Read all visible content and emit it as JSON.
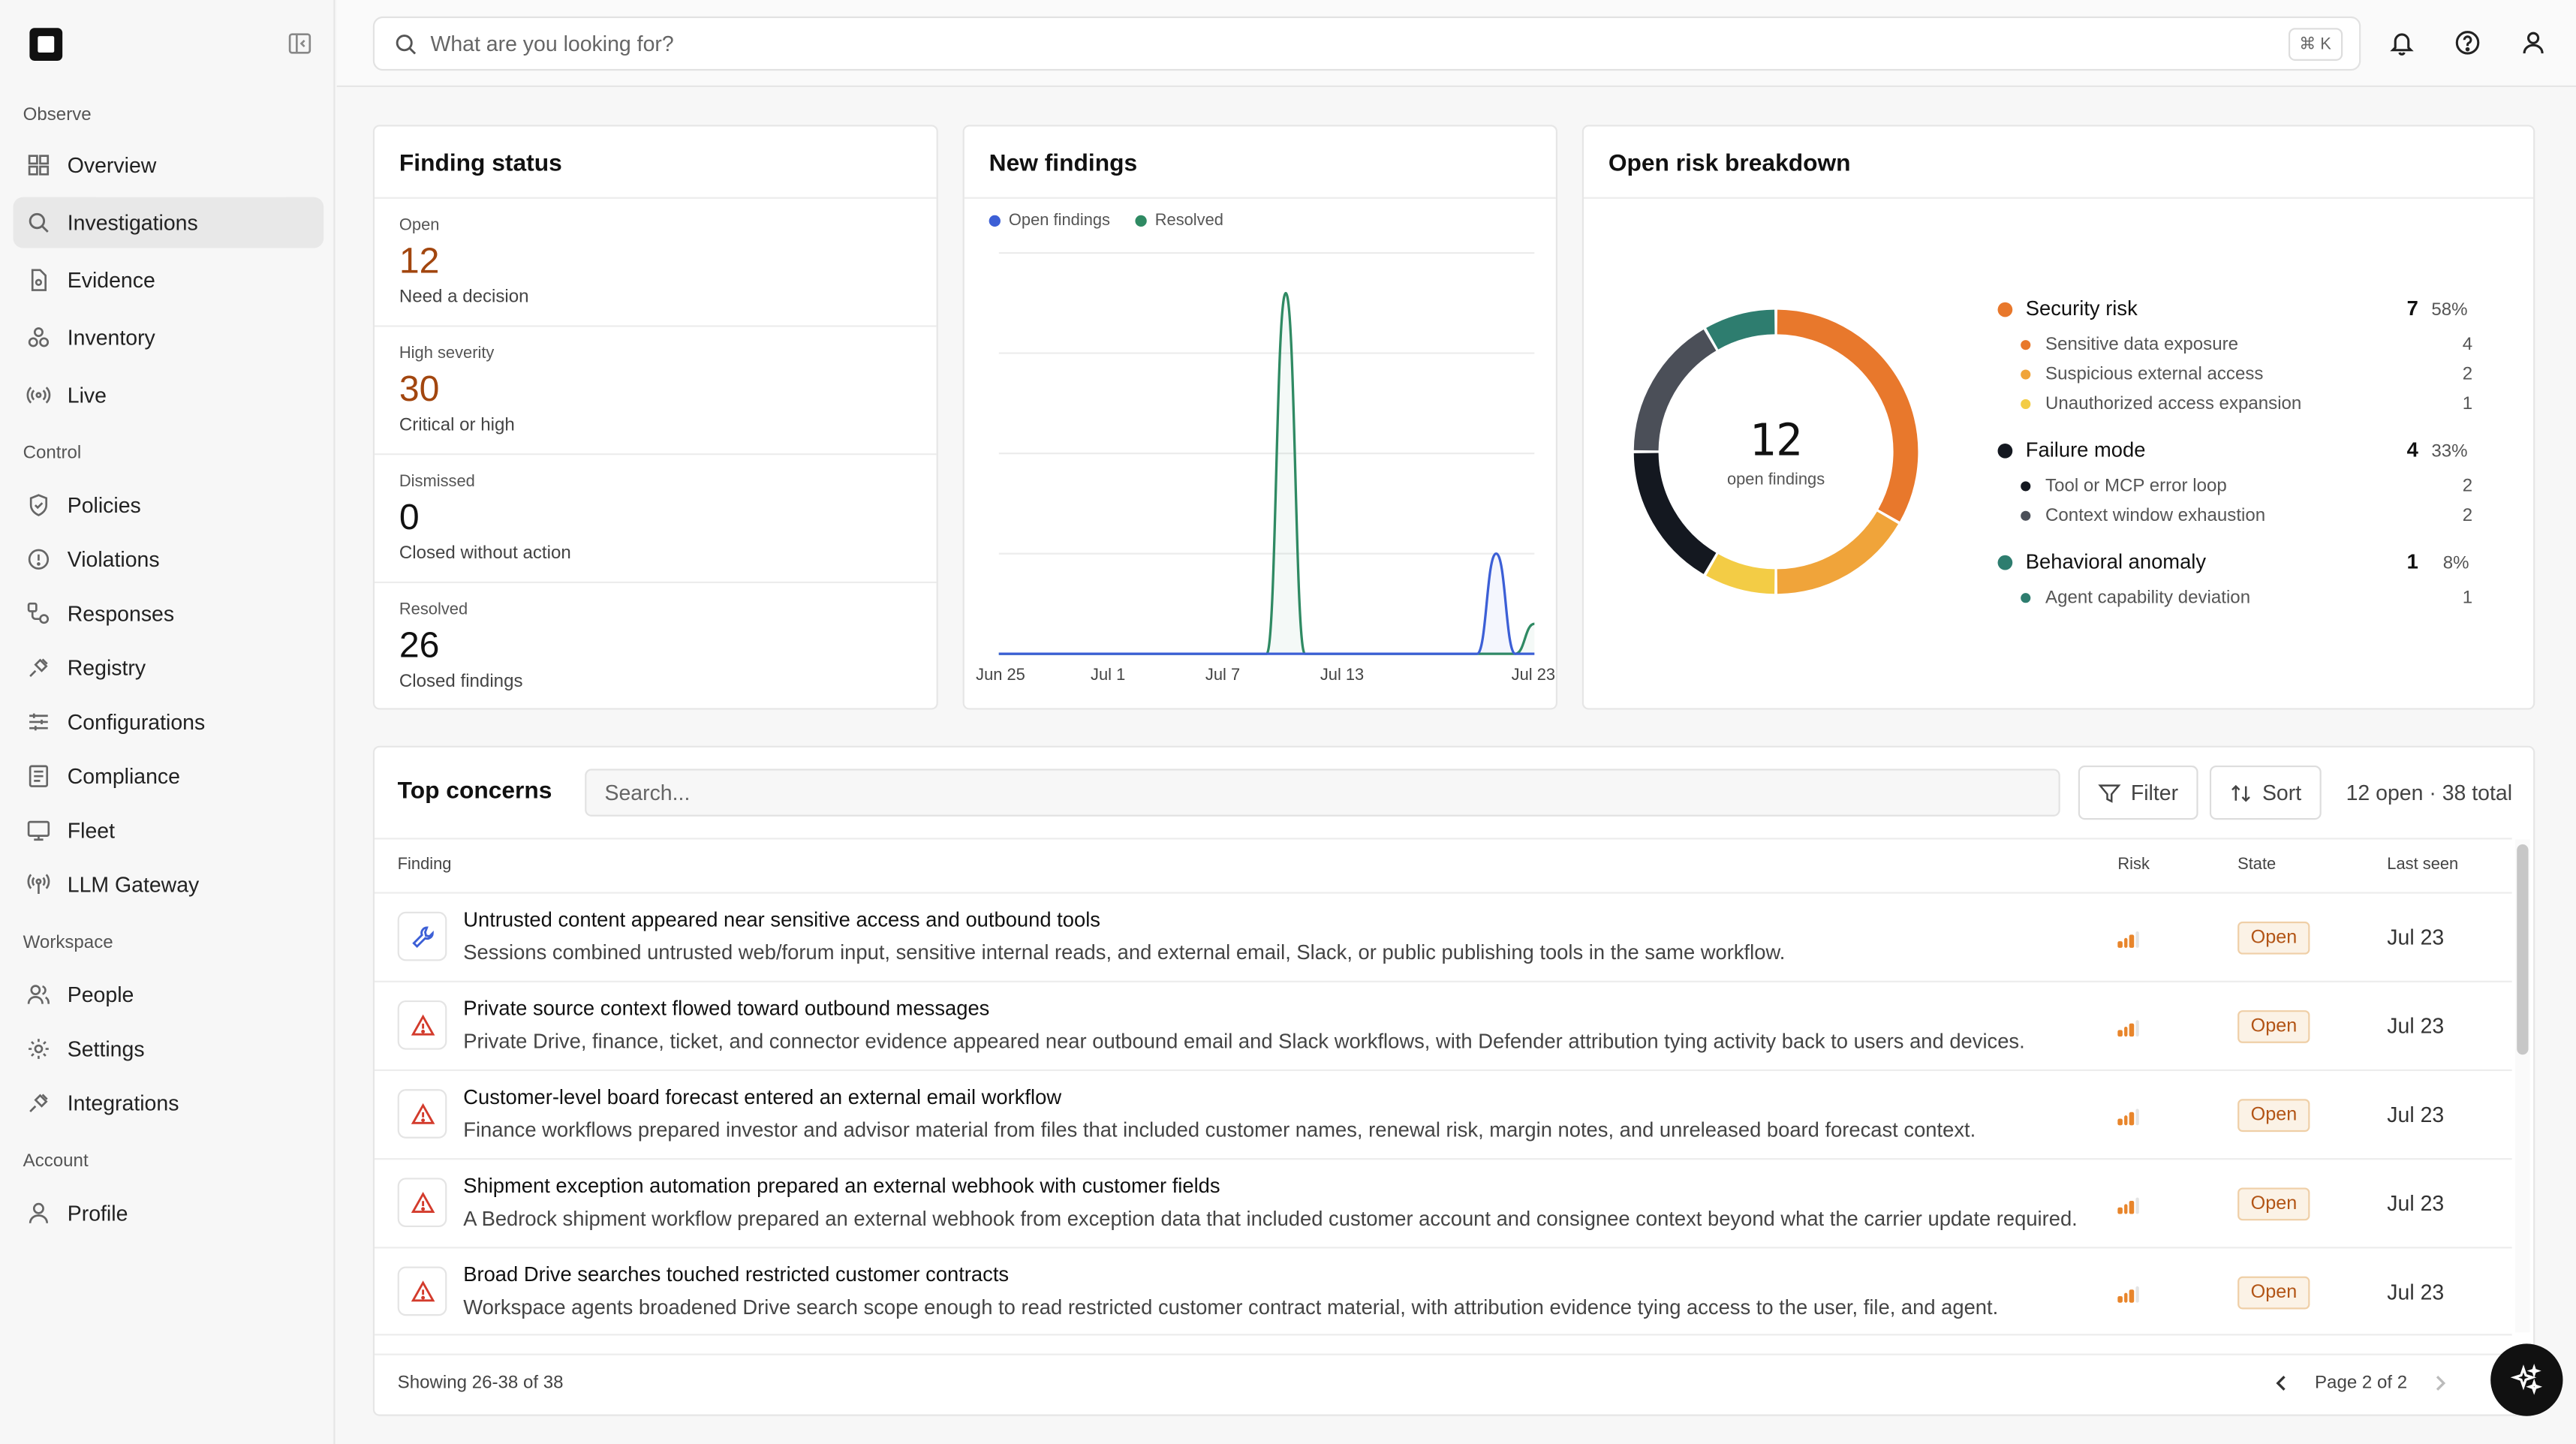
{
  "search": {
    "placeholder": "What are you looking for?",
    "shortcut": "⌘ K"
  },
  "sidebar": {
    "sections": {
      "observe": "Observe",
      "control": "Control",
      "workspace": "Workspace",
      "account": "Account"
    },
    "items": [
      {
        "label": "Overview",
        "icon": "grid-icon"
      },
      {
        "label": "Investigations",
        "icon": "search-doc-icon",
        "active": true
      },
      {
        "label": "Evidence",
        "icon": "file-icon"
      },
      {
        "label": "Inventory",
        "icon": "boxes-icon"
      },
      {
        "label": "Live",
        "icon": "broadcast-icon"
      },
      {
        "label": "Policies",
        "icon": "shield-icon"
      },
      {
        "label": "Violations",
        "icon": "alert-circle-icon"
      },
      {
        "label": "Responses",
        "icon": "workflow-icon"
      },
      {
        "label": "Registry",
        "icon": "plug-icon"
      },
      {
        "label": "Configurations",
        "icon": "sliders-icon"
      },
      {
        "label": "Compliance",
        "icon": "checklist-icon"
      },
      {
        "label": "Fleet",
        "icon": "monitor-icon"
      },
      {
        "label": "LLM Gateway",
        "icon": "antenna-icon"
      },
      {
        "label": "People",
        "icon": "users-icon"
      },
      {
        "label": "Settings",
        "icon": "gear-icon"
      },
      {
        "label": "Integrations",
        "icon": "plug-icon"
      },
      {
        "label": "Profile",
        "icon": "user-icon"
      }
    ]
  },
  "finding_status": {
    "title": "Finding status",
    "stats": [
      {
        "label": "Open",
        "value": "12",
        "sub": "Need a decision"
      },
      {
        "label": "High severity",
        "value": "30",
        "sub": "Critical or high"
      },
      {
        "label": "Dismissed",
        "value": "0",
        "sub": "Closed without action"
      },
      {
        "label": "Resolved",
        "value": "26",
        "sub": "Closed findings"
      }
    ]
  },
  "new_findings": {
    "title": "New findings",
    "legend": {
      "open": "Open findings",
      "resolved": "Resolved"
    },
    "colors": {
      "open": "#3c5fd6",
      "resolved": "#2f8a63"
    }
  },
  "chart_data": {
    "type": "line",
    "x_ticks": [
      "Jun 25",
      "Jul 1",
      "Jul 7",
      "Jul 13",
      "Jul 23"
    ],
    "x": [
      "Jun 25",
      "Jun 26",
      "Jun 27",
      "Jun 28",
      "Jun 29",
      "Jun 30",
      "Jul 1",
      "Jul 2",
      "Jul 3",
      "Jul 4",
      "Jul 5",
      "Jul 6",
      "Jul 7",
      "Jul 8",
      "Jul 9",
      "Jul 10",
      "Jul 11",
      "Jul 12",
      "Jul 13",
      "Jul 14",
      "Jul 15",
      "Jul 16",
      "Jul 17",
      "Jul 18",
      "Jul 19",
      "Jul 20",
      "Jul 21",
      "Jul 22",
      "Jul 23"
    ],
    "series": [
      {
        "name": "Open findings",
        "values": [
          0,
          0,
          0,
          0,
          0,
          0,
          0,
          0,
          0,
          0,
          0,
          0,
          0,
          0,
          0,
          0,
          0,
          0,
          0,
          0,
          0,
          0,
          0,
          0,
          0,
          0,
          1,
          0,
          0
        ]
      },
      {
        "name": "Resolved",
        "values": [
          0,
          0,
          0,
          0,
          0,
          0,
          0,
          0,
          0,
          0,
          0,
          0,
          0,
          0,
          0,
          3.6,
          0,
          0,
          0,
          0,
          0,
          0,
          0,
          0,
          0,
          0,
          0,
          0,
          0.3
        ]
      }
    ],
    "ylim": [
      0,
      4
    ],
    "grid": true,
    "legend_position": "top-left"
  },
  "risk_breakdown": {
    "title": "Open risk breakdown",
    "center_value": "12",
    "center_label": "open findings",
    "groups": [
      {
        "name": "Security risk",
        "count": "7",
        "pct": "58%",
        "color": "#e8782c",
        "items": [
          {
            "name": "Sensitive data exposure",
            "count": "4",
            "color": "#e8782c"
          },
          {
            "name": "Suspicious external access",
            "count": "2",
            "color": "#f0a43a"
          },
          {
            "name": "Unauthorized access expansion",
            "count": "1",
            "color": "#f3cc45"
          }
        ]
      },
      {
        "name": "Failure mode",
        "count": "4",
        "pct": "33%",
        "color": "#141820",
        "items": [
          {
            "name": "Tool or MCP error loop",
            "count": "2",
            "color": "#141820"
          },
          {
            "name": "Context window exhaustion",
            "count": "2",
            "color": "#4b4f58"
          }
        ]
      },
      {
        "name": "Behavioral anomaly",
        "count": "1",
        "pct": "8%",
        "color": "#2e7d6f",
        "items": [
          {
            "name": "Agent capability deviation",
            "count": "1",
            "color": "#2e7d6f"
          }
        ]
      }
    ]
  },
  "concerns": {
    "title": "Top concerns",
    "search_placeholder": "Search...",
    "filter_label": "Filter",
    "sort_label": "Sort",
    "summary": "12 open · 38 total",
    "columns": {
      "finding": "Finding",
      "risk": "Risk",
      "state": "State",
      "last_seen": "Last seen"
    },
    "rows": [
      {
        "icon": "wrench-icon",
        "title": "Untrusted content appeared near sensitive access and outbound tools",
        "desc": "Sessions combined untrusted web/forum input, sensitive internal reads, and external email, Slack, or public publishing tools in the same workflow.",
        "risk": 3,
        "state": "Open",
        "date": "Jul 23"
      },
      {
        "icon": "warning-icon",
        "title": "Private source context flowed toward outbound messages",
        "desc": "Private Drive, finance, ticket, and connector evidence appeared near outbound email and Slack workflows, with Defender attribution tying activity back to users and devices.",
        "risk": 3,
        "state": "Open",
        "date": "Jul 23"
      },
      {
        "icon": "warning-icon",
        "title": "Customer-level board forecast entered an external email workflow",
        "desc": "Finance workflows prepared investor and advisor material from files that included customer names, renewal risk, margin notes, and unreleased board forecast context.",
        "risk": 3,
        "state": "Open",
        "date": "Jul 23"
      },
      {
        "icon": "warning-icon",
        "title": "Shipment exception automation prepared an external webhook with customer fields",
        "desc": "A Bedrock shipment workflow prepared an external webhook from exception data that included customer account and consignee context beyond what the carrier update required.",
        "risk": 3,
        "state": "Open",
        "date": "Jul 23"
      },
      {
        "icon": "warning-icon",
        "title": "Broad Drive searches touched restricted customer contracts",
        "desc": "Workspace agents broadened Drive search scope enough to read restricted customer contract material, with attribution evidence tying access to the user, file, and agent.",
        "risk": 3,
        "state": "Open",
        "date": "Jul 23"
      }
    ],
    "showing": "Showing 26-38 of 38",
    "page": "Page 2 of 2"
  }
}
